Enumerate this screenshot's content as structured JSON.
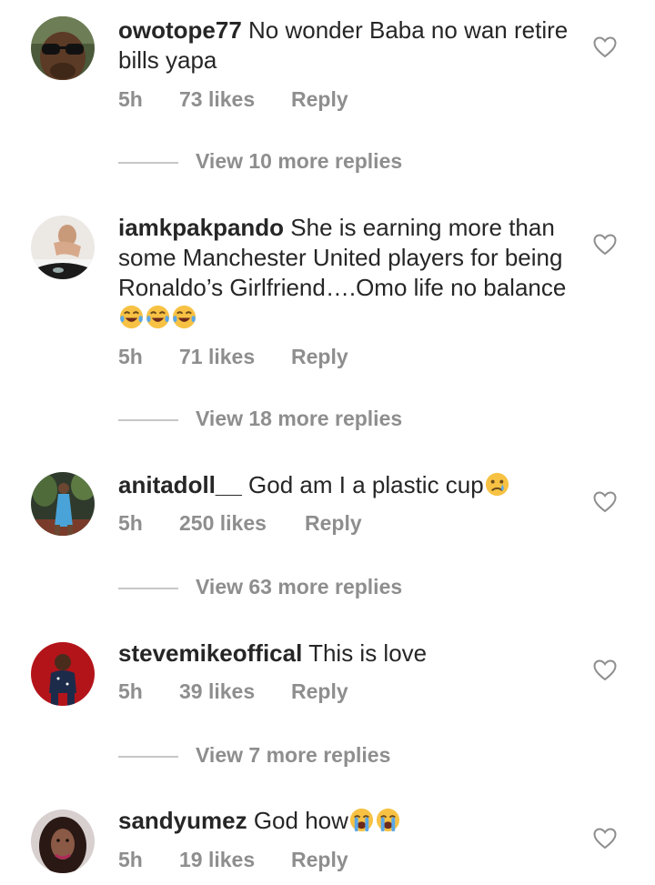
{
  "comments": [
    {
      "username": "owotope77",
      "text": " No wonder Baba no wan retire bills yapa",
      "time": "5h",
      "likes": "73 likes",
      "reply": "Reply",
      "view_more": "View 10 more replies",
      "avatar_icon": "avatar-sunglasses-man",
      "emojis": []
    },
    {
      "username": "iamkpakpando",
      "text": " She is earning more than some Manchester United players for being Ronaldo’s Girlfriend….Omo life no balance ",
      "time": "5h",
      "likes": "71 likes",
      "reply": "Reply",
      "view_more": "View 18 more replies",
      "avatar_icon": "avatar-person-with-car",
      "emojis": [
        "face-with-tears-of-joy",
        "face-with-tears-of-joy",
        "face-with-tears-of-joy"
      ]
    },
    {
      "username": "anitadoll__",
      "text": " God am I a plastic cup",
      "time": "5h",
      "likes": "250 likes",
      "reply": "Reply",
      "view_more": "View 63 more replies",
      "avatar_icon": "avatar-woman-in-blue-dress",
      "emojis": [
        "crying-face"
      ]
    },
    {
      "username": "stevemikeoffical",
      "text": " This is love",
      "time": "5h",
      "likes": "39 likes",
      "reply": "Reply",
      "view_more": "View 7 more replies",
      "avatar_icon": "avatar-man-red-background",
      "emojis": []
    },
    {
      "username": "sandyumez",
      "text": " God how",
      "time": "5h",
      "likes": "19 likes",
      "reply": "Reply",
      "view_more": "",
      "avatar_icon": "avatar-woman-portrait",
      "emojis": [
        "loudly-crying-face",
        "loudly-crying-face"
      ]
    }
  ],
  "colors": {
    "text": "#262626",
    "meta": "#8e8e8e",
    "divider": "#c7c7c7",
    "emoji_yellow": "#f7c244",
    "tear_blue": "#5aa7e8"
  },
  "like_icon": "heart-outline-icon"
}
